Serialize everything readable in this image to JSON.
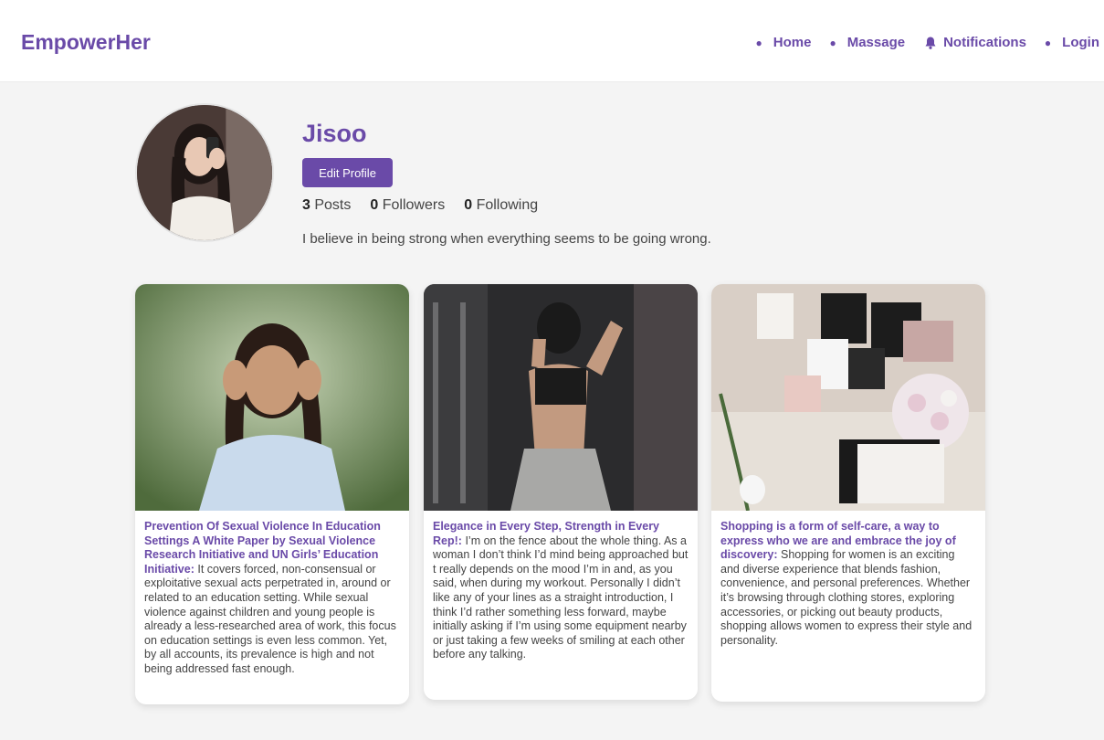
{
  "nav": {
    "brand": "EmpowerHer",
    "links": [
      {
        "label": "Home"
      },
      {
        "label": "Massage"
      },
      {
        "label": "Notifications",
        "icon": "bell-icon"
      },
      {
        "label": "Login"
      }
    ]
  },
  "profile": {
    "username": "Jisoo",
    "edit_label": "Edit Profile",
    "posts_count": "3",
    "posts_label": "Posts",
    "followers_count": "0",
    "followers_label": "Followers",
    "following_count": "0",
    "following_label": "Following",
    "bio": "I believe in being strong when everything seems to be going wrong."
  },
  "posts": [
    {
      "title": "Prevention Of Sexual Violence In Education Settings A White Paper by Sexual Violence Research Initiative and UN Girls’ Education Initiative:",
      "body": "It covers forced, non-consensual or exploitative sexual acts perpetrated in, around or related to an education setting. While sexual violence against children and young people is already a less-researched area of work, this focus on education settings is even less common. Yet, by all accounts, its prevalence is high and not being addressed fast enough."
    },
    {
      "title": "Elegance in Every Step, Strength in Every Rep!:",
      "body": "I’m on the fence about the whole thing. As a woman I don’t think I’d mind being approached but t really depends on the mood I’m in and, as you said, when during my workout. Personally I didn’t like any of your lines as a straight introduction, I think I’d rather something less forward, maybe initially asking if I’m using some equipment nearby or just taking a few weeks of smiling at each other before any talking."
    },
    {
      "title": "Shopping is a form of self-care, a way to express who we are and embrace the joy of discovery:",
      "body": "Shopping for women is an exciting and diverse experience that blends fashion, convenience, and personal preferences. Whether it’s browsing through clothing stores, exploring accessories, or picking out beauty products, shopping allows women to express their style and personality."
    }
  ],
  "colors": {
    "accent": "#6a4aa8",
    "background": "#f4f4f4"
  }
}
